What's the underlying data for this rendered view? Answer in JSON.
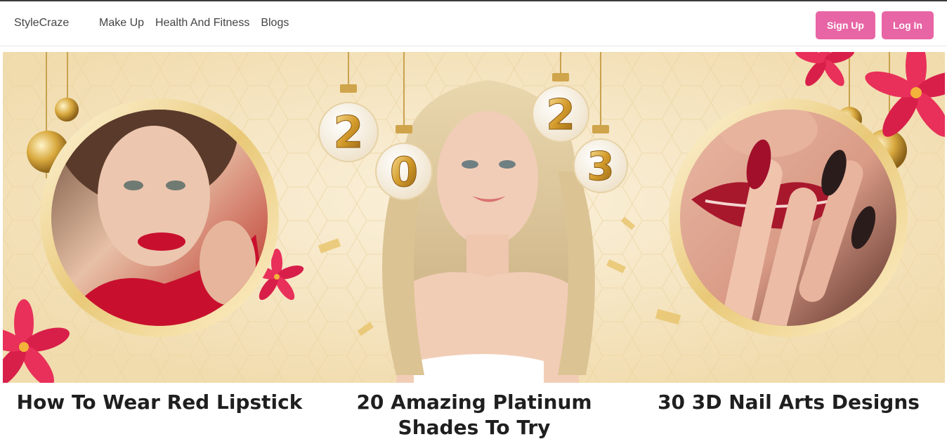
{
  "nav": {
    "brand": "StyleCraze",
    "links": [
      "Make Up",
      "Health And Fitness",
      "Blogs"
    ],
    "signup_label": "Sign Up",
    "login_label": "Log In",
    "accent_color": "#e865a5"
  },
  "hero": {
    "year_digits": [
      "2",
      "0",
      "2",
      "3"
    ],
    "palette": {
      "cream": "#f6e6c4",
      "gold": "#d6a53a",
      "red": "#c8102e",
      "pink": "#e8305a"
    }
  },
  "articles": [
    {
      "title": "How To Wear Red Lipstick"
    },
    {
      "title": "20 Amazing Platinum Shades To Try"
    },
    {
      "title": "30 3D Nail Arts Designs"
    }
  ]
}
